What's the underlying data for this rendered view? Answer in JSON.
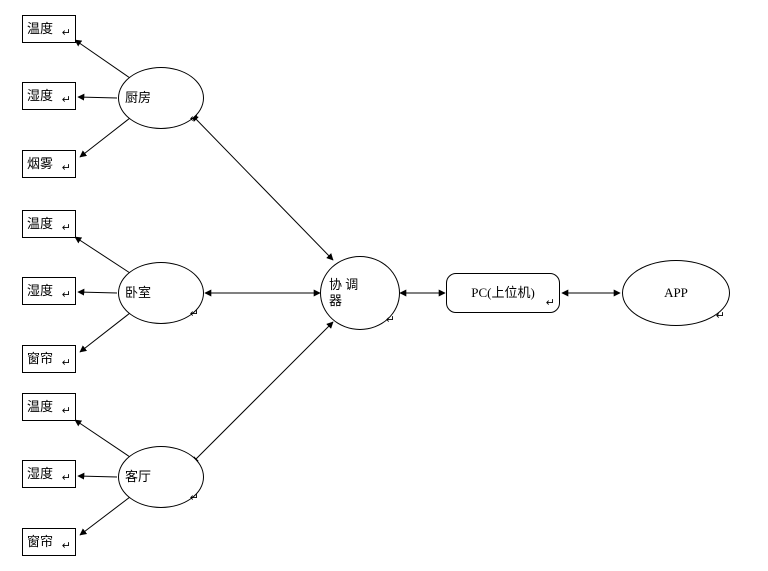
{
  "nodes": {
    "kitchen": {
      "label": "厨房"
    },
    "bedroom": {
      "label": "卧室"
    },
    "living": {
      "label": "客厅"
    },
    "coord": {
      "label": "协 调 器"
    },
    "pc": {
      "label": "PC(上位机)"
    },
    "app": {
      "label": "APP"
    }
  },
  "sensors": {
    "kitchen": [
      {
        "id": "temp",
        "label": "温度"
      },
      {
        "id": "humid",
        "label": "湿度"
      },
      {
        "id": "smoke",
        "label": "烟雾"
      }
    ],
    "bedroom": [
      {
        "id": "temp",
        "label": "温度"
      },
      {
        "id": "humid",
        "label": "湿度"
      },
      {
        "id": "curtain",
        "label": "窗帘"
      }
    ],
    "living": [
      {
        "id": "temp",
        "label": "温度"
      },
      {
        "id": "humid",
        "label": "湿度"
      },
      {
        "id": "curtain",
        "label": "窗帘"
      }
    ]
  },
  "glyphs": {
    "cj": "↵"
  },
  "edges": [
    {
      "from": "kitchen",
      "to": "coord",
      "dir": "both"
    },
    {
      "from": "bedroom",
      "to": "coord",
      "dir": "both"
    },
    {
      "from": "living",
      "to": "coord",
      "dir": "both"
    },
    {
      "from": "coord",
      "to": "pc",
      "dir": "both"
    },
    {
      "from": "pc",
      "to": "app",
      "dir": "both"
    },
    {
      "from": "kitchen",
      "to": "kitchen.temp",
      "dir": "to"
    },
    {
      "from": "kitchen",
      "to": "kitchen.humid",
      "dir": "to"
    },
    {
      "from": "kitchen",
      "to": "kitchen.smoke",
      "dir": "to"
    },
    {
      "from": "bedroom",
      "to": "bedroom.temp",
      "dir": "to"
    },
    {
      "from": "bedroom",
      "to": "bedroom.humid",
      "dir": "to"
    },
    {
      "from": "bedroom",
      "to": "bedroom.curtain",
      "dir": "to"
    },
    {
      "from": "living",
      "to": "living.temp",
      "dir": "to"
    },
    {
      "from": "living",
      "to": "living.humid",
      "dir": "to"
    },
    {
      "from": "living",
      "to": "living.curtain",
      "dir": "to"
    }
  ]
}
